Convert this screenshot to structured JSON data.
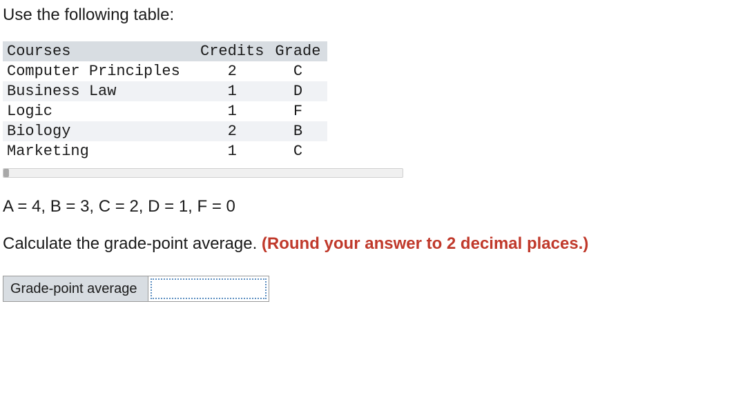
{
  "intro": "Use the following table:",
  "table": {
    "headers": {
      "courses": "Courses",
      "credits": "Credits",
      "grade": "Grade"
    },
    "rows": [
      {
        "course": "Computer Principles",
        "credits": "2",
        "grade": "C"
      },
      {
        "course": "Business Law",
        "credits": "1",
        "grade": "D"
      },
      {
        "course": "Logic",
        "credits": "1",
        "grade": "F"
      },
      {
        "course": "Biology",
        "credits": "2",
        "grade": "B"
      },
      {
        "course": "Marketing",
        "credits": "1",
        "grade": "C"
      }
    ]
  },
  "grade_scale": "A = 4, B = 3, C = 2, D = 1, F = 0",
  "calc_prompt": "Calculate the grade-point average. ",
  "calc_emphasis": "(Round your answer to 2 decimal places.)",
  "answer": {
    "label": "Grade-point average",
    "value": ""
  }
}
